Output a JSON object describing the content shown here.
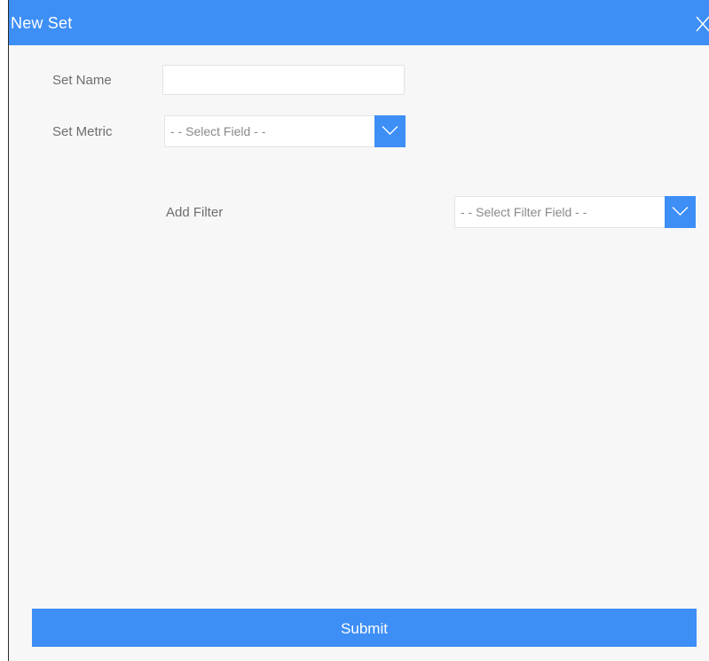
{
  "dialog": {
    "title": "New Set",
    "close_icon": "close-icon"
  },
  "form": {
    "set_name_label": "Set Name",
    "set_name_value": "",
    "set_metric_label": "Set Metric",
    "set_metric_selected": "- - Select Field - -",
    "add_filter_label": "Add Filter",
    "filter_field_selected": "- - Select Filter Field - -",
    "dropdown_icon": "chevron-down-icon"
  },
  "actions": {
    "submit_label": "Submit"
  },
  "colors": {
    "accent": "#3d8ef5",
    "background": "#f7f7f7",
    "label_text": "#6e6e6e"
  }
}
